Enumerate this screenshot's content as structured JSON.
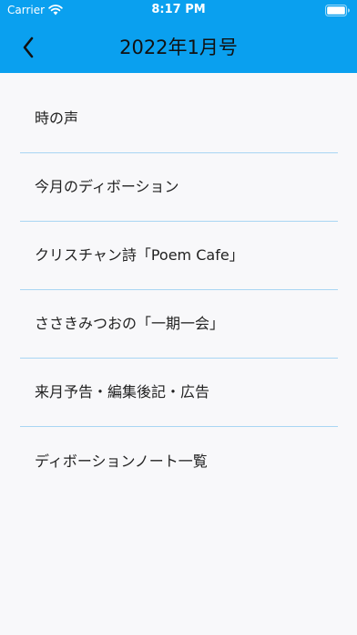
{
  "status_bar": {
    "carrier": "Carrier",
    "time": "8:17 PM"
  },
  "nav": {
    "title": "2022年1月号",
    "back_icon": "chevron-left-icon"
  },
  "menu": {
    "items": [
      {
        "label": "時の声"
      },
      {
        "label": "今月のディボーション"
      },
      {
        "label": "クリスチャン詩「Poem Cafe」"
      },
      {
        "label": "ささきみつおの「一期一会」"
      },
      {
        "label": "来月予告・編集後記・広告"
      },
      {
        "label": "ディボーションノート一覧"
      }
    ]
  },
  "colors": {
    "header_bg": "#0aa0ef",
    "divider": "#a9d6f3",
    "background": "#f8f8fa"
  }
}
